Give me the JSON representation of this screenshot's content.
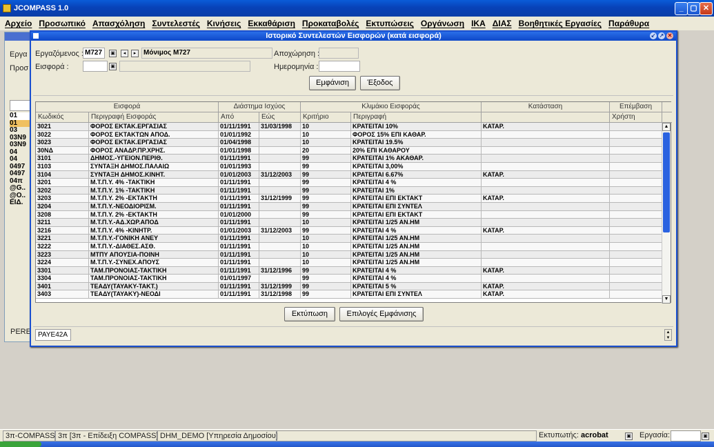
{
  "app": {
    "title": "JCOMPASS 1.0"
  },
  "menu": [
    "Αρχείο",
    "Προσωπικό",
    "Απασχόληση",
    "Συντελεστές",
    "Κινήσεις",
    "Εκκαθάριση",
    "Προκαταβολές",
    "Εκτυπώσεις",
    "Οργάνωση",
    "ΙΚΑ",
    "ΔΙΑΣ",
    "Βοηθητικές Εργασίες",
    "Παράθυρα"
  ],
  "back_window": {
    "labels": [
      "Εργα",
      "Προσ"
    ],
    "list": [
      "01",
      "01",
      "03",
      "03N9",
      "03N9",
      "04",
      "04",
      "0497",
      "0497",
      "04π",
      "@G..",
      "@O..",
      "ΕΙΔ."
    ],
    "footer": "PERE"
  },
  "dialog": {
    "title": "Ιστορικό Συντελεστών Εισφορών (κατά εισφορά)",
    "employee_label": "Εργαζόμενος :",
    "employee_code": "M727",
    "employee_name": "Μόνιμος M727",
    "contribution_label": "Εισφορά :",
    "contribution_value": "",
    "departure_label": "Αποχώρηση :",
    "date_label": "Ημερομηνία :",
    "show_button": "Εμφάνιση",
    "exit_button": "Έξοδος",
    "print_button": "Εκτύπωση",
    "options_button": "Επιλογές Εμφάνισης",
    "form_code": "PAYE42A"
  },
  "grid": {
    "group_headers": [
      "Εισφορά",
      "Διάστημα Ισχύος",
      "Κλιμάκιο Εισφοράς",
      "Κατάσταση",
      "Επέμβαση"
    ],
    "columns": [
      "Κωδικός",
      "Περιγραφή Εισφοράς",
      "Από",
      "Εώς",
      "Κριτήριο",
      "Περιγραφή",
      "",
      "Χρήστη"
    ],
    "rows": [
      [
        "3021",
        "ΦΟΡΟΣ ΕΚΤΑΚ.ΕΡΓΑΣΙΑΣ",
        "01/11/1991",
        "31/03/1998",
        "10",
        "ΚΡΑΤΕΙΤΑΙ 10%",
        "ΚΑΤΑΡ.",
        ""
      ],
      [
        "3022",
        "ΦΟΡΟΣ ΕΚΤΑΚΤΩΝ ΑΠΟΔ.",
        "01/01/1992",
        "",
        "10",
        "ΦΟΡΟΣ 15% ΕΠΙ ΚΑΘΑΡ.",
        "",
        ""
      ],
      [
        "3023",
        "ΦΟΡΟΣ ΕΚΤΑΚ.ΕΡΓΑΣΙΑΣ",
        "01/04/1998",
        "",
        "10",
        "ΚΡΑΤΕΙΤΑΙ 19.5%",
        "",
        ""
      ],
      [
        "30ΝΔ",
        "ΦΟΡΟΣ ΑΝΑΔΡ.ΠΡ.ΧΡΗΣ.",
        "01/01/1998",
        "",
        "20",
        "20% ΕΠΙ ΚΑΘΑΡΟΥ",
        "",
        ""
      ],
      [
        "3101",
        "ΔΗΜΟΣ.-ΥΓΕΙΟΝ.ΠΕΡΙΘ.",
        "01/11/1991",
        "",
        "99",
        "ΚΡΑΤΕΙΤΑΙ 1% ΑΚΑΘΑΡ.",
        "",
        ""
      ],
      [
        "3103",
        "ΣΥΝΤΑΞΗ ΔΗΜΟΣ.ΠΑΛΑΙΩ",
        "01/01/1993",
        "",
        "99",
        "ΚΡΑΤΕΙΤΑΙ 3,00%",
        "",
        ""
      ],
      [
        "3104",
        "ΣΥΝΤΑΞΗ ΔΗΜΟΣ.ΚΙΝΗΤ.",
        "01/01/2003",
        "31/12/2003",
        "99",
        "ΚΡΑΤΕΙΤΑΙ 6.67%",
        "ΚΑΤΑΡ.",
        ""
      ],
      [
        "3201",
        "Μ.Τ.Π.Υ. 4% -ΤΑΚΤΙΚΗ",
        "01/11/1991",
        "",
        "99",
        "ΚΡΑΤΕΙΤΑΙ 4 %",
        "",
        ""
      ],
      [
        "3202",
        "Μ.Τ.Π.Υ. 1% -ΤΑΚΤΙΚΗ",
        "01/11/1991",
        "",
        "99",
        "ΚΡΑΤΕΙΤΑΙ 1%",
        "",
        ""
      ],
      [
        "3203",
        "Μ.Τ.Π.Υ. 2% -ΕΚΤΑΚΤΗ",
        "01/11/1991",
        "31/12/1999",
        "99",
        "ΚΡΑΤΕΙΤΑΙ ΕΠΙ ΕΚΤΑΚΤ",
        "ΚΑΤΑΡ.",
        ""
      ],
      [
        "3204",
        "Μ.Τ.Π.Υ.-ΝΕΟΔΙΟΡΙΣΜ.",
        "01/11/1991",
        "",
        "99",
        "ΚΡΑΤΕΙΤΑΙ ΕΠΙ ΣΥΝΤΕΛ",
        "",
        ""
      ],
      [
        "3208",
        "Μ.Τ.Π.Υ. 2% -ΕΚΤΑΚΤΗ",
        "01/01/2000",
        "",
        "99",
        "ΚΡΑΤΕΙΤΑΙ ΕΠΙ ΕΚΤΑΚΤ",
        "",
        ""
      ],
      [
        "3211",
        "Μ.Τ.Π.Υ.-ΑΔ.ΧΩΡ.ΑΠΟΔ",
        "01/11/1991",
        "",
        "10",
        "ΚΡΑΤΕΙΤΑΙ 1/25 ΑΝ.ΗΜ",
        "",
        ""
      ],
      [
        "3216",
        "Μ.Τ.Π.Υ. 4% -ΚΙΝΗΤΡ.",
        "01/01/2003",
        "31/12/2003",
        "99",
        "ΚΡΑΤΕΙΤΑΙ 4 %",
        "ΚΑΤΑΡ.",
        ""
      ],
      [
        "3221",
        "Μ.Τ.Π.Υ.-ΓΟΝΙΚΗ ΑΝΕΥ",
        "01/11/1991",
        "",
        "10",
        "ΚΡΑΤΕΙΤΑΙ 1/25 ΑΝ.ΗΜ",
        "",
        ""
      ],
      [
        "3222",
        "Μ.Τ.Π.Υ.-ΔΙΑΘΕΣ.ΑΣΘ.",
        "01/11/1991",
        "",
        "10",
        "ΚΡΑΤΕΙΤΑΙ 1/25 ΑΝ.ΗΜ",
        "",
        ""
      ],
      [
        "3223",
        "ΜΤΠΥ ΑΠΟΥΣΙΑ-ΠΟΙΝΗ",
        "01/11/1991",
        "",
        "10",
        "ΚΡΑΤΕΙΤΑΙ 1/25 ΑΝ.ΗΜ",
        "",
        ""
      ],
      [
        "3224",
        "Μ.Τ.Π.Υ.-ΣΥΝΕΧ.ΑΠΟΥΣ",
        "01/11/1991",
        "",
        "10",
        "ΚΡΑΤΕΙΤΑΙ 1/25 ΑΝ.ΗΜ",
        "",
        ""
      ],
      [
        "3301",
        "ΤΑΜ.ΠΡΟΝΟΙΑΣ-ΤΑΚΤΙΚΗ",
        "01/11/1991",
        "31/12/1996",
        "99",
        "ΚΡΑΤΕΙΤΑΙ 4 %",
        "ΚΑΤΑΡ.",
        ""
      ],
      [
        "3304",
        "ΤΑΜ.ΠΡΟΝΟΙΑΣ-ΤΑΚΤΙΚΗ",
        "01/01/1997",
        "",
        "99",
        "ΚΡΑΤΕΙΤΑΙ 4 %",
        "",
        ""
      ],
      [
        "3401",
        "ΤΕΑΔΥ(ΤΑΥΑΚΥ-ΤΑΚΤ.)",
        "01/11/1991",
        "31/12/1999",
        "99",
        "ΚΡΑΤΕΙΤΑΙ 5 %",
        "ΚΑΤΑΡ.",
        ""
      ],
      [
        "3403",
        "ΤΕΑΔΥ(ΤΑΥΑΚΥ)-ΝΕΟΔΙ",
        "01/11/1991",
        "31/12/1998",
        "99",
        "ΚΡΑΤΕΙΤΑΙ ΕΠΙ ΣΥΝΤΕΛ",
        "ΚΑΤΑΡ.",
        ""
      ]
    ]
  },
  "status": {
    "cells": [
      "3π-COMPASS",
      "3π [3π - Επίδειξη COMPASS]",
      "DHM_DEMO [Υπηρεσία Δημοσίου]"
    ],
    "printer_label": "Εκτυπωτής:",
    "printer_value": "acrobat",
    "task_label": "Εργασία:"
  },
  "colors": {
    "titlebar": "#0a5cd8",
    "window_border": "#1a50d0",
    "face": "#ece9d8",
    "scroll_thumb": "#2a62e0"
  }
}
